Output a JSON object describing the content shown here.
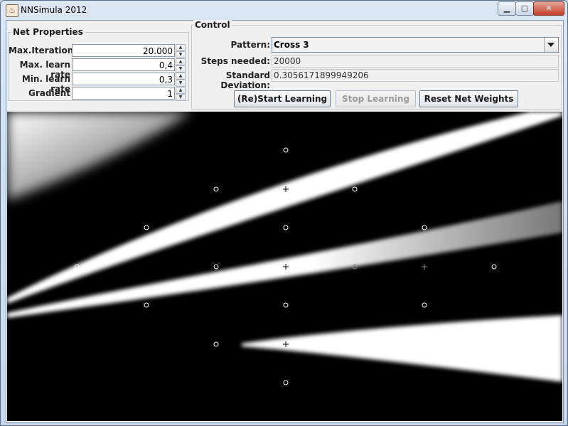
{
  "window": {
    "title": "NNSimula 2012",
    "app_icon": "app-icon",
    "minimize_icon": "minimize-icon",
    "maximize_icon": "maximize-icon",
    "close_icon": "close-icon"
  },
  "net_properties": {
    "title": "Net Properties",
    "fields": [
      {
        "label": "Max.Iterations",
        "value": "20.000"
      },
      {
        "label": "Max. learn rate",
        "value": "0,4"
      },
      {
        "label": "Min. learn rate",
        "value": "0,3"
      },
      {
        "label": "Gradient",
        "value": "1"
      }
    ]
  },
  "control": {
    "title": "Control",
    "pattern_label": "Pattern:",
    "pattern_value": "Cross 3",
    "steps_label": "Steps needed:",
    "steps_value": "20000",
    "stddev_label": "Standard Deviation:",
    "stddev_value": "0.3056171899949206",
    "buttons": {
      "start": "(Re)Start Learning",
      "stop": "Stop Learning",
      "reset": "Reset Net Weights"
    }
  },
  "visualization": {
    "background_color": "#000000",
    "band_color": "#ffffff",
    "marker_color": "#ffffff",
    "markers_circle_count": 20,
    "markers_cross_count": 6
  }
}
